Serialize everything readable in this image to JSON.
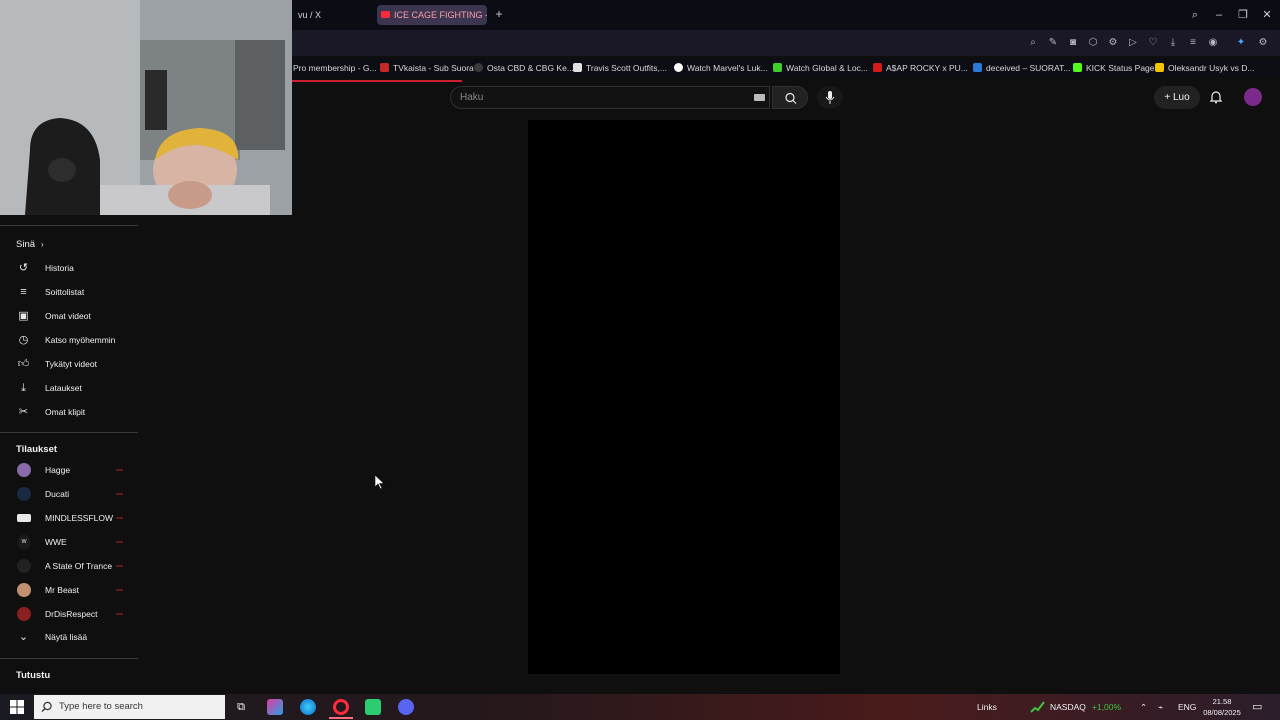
{
  "browser": {
    "tabs": [
      {
        "label": "vu / X"
      },
      {
        "label": "ICE CAGE FIGHTING -"
      }
    ],
    "bookmarks": [
      {
        "label": "Pro membership - G...",
        "color": "#0d0d14"
      },
      {
        "label": "TVkaista - Sub Suora",
        "color": "#c62828"
      },
      {
        "label": "Osta CBD & CBG Ke...",
        "color": "#3a3a3a"
      },
      {
        "label": "Travis Scott Outfits,...",
        "color": "#e0e0e0"
      },
      {
        "label": "Watch Marvel's Luk...",
        "color": "#ffffff"
      },
      {
        "label": "Watch Global & Loc...",
        "color": "#3ecf2a"
      },
      {
        "label": "A$AP ROCKY x PU...",
        "color": "#d61a1a"
      },
      {
        "label": "deceived – SUORAT...",
        "color": "#2a7ad6"
      },
      {
        "label": "KICK Status Page",
        "color": "#53fc18"
      },
      {
        "label": "Oleksandr Usyk vs D...",
        "color": "#f2c500"
      }
    ]
  },
  "header": {
    "search_placeholder": "Haku",
    "create_label": "Luo"
  },
  "sidebar": {
    "you_label": "Sinä",
    "you_items": [
      {
        "label": "Historia",
        "icon": "history-icon"
      },
      {
        "label": "Soittolistat",
        "icon": "playlists-icon"
      },
      {
        "label": "Omat videot",
        "icon": "your-videos-icon"
      },
      {
        "label": "Katso myöhemmin",
        "icon": "watch-later-icon"
      },
      {
        "label": "Tykätyt videot",
        "icon": "liked-icon"
      },
      {
        "label": "Lataukset",
        "icon": "download-icon"
      },
      {
        "label": "Omat klipit",
        "icon": "clips-icon"
      }
    ],
    "subs_label": "Tilaukset",
    "subscriptions": [
      {
        "label": "Hagge",
        "color": "#8a6aa8"
      },
      {
        "label": "Ducati",
        "color": "#1b2a44"
      },
      {
        "label": "MINDLESSFLOW",
        "color": "#e8e8e8"
      },
      {
        "label": "WWE",
        "color": "#1a1a1a"
      },
      {
        "label": "A State Of Trance",
        "color": "#222222"
      },
      {
        "label": "Mr Beast",
        "color": "#c09070"
      },
      {
        "label": "DrDisRespect",
        "color": "#8a2020"
      }
    ],
    "show_more": "Näytä lisää",
    "explore_label": "Tutustu"
  },
  "taskbar": {
    "search_placeholder": "Type here to search",
    "links": "Links",
    "ticker": "NASDAQ",
    "ticker_change": "+1,00%",
    "lang": "ENG",
    "time": "21.58",
    "date": "08/08/2025"
  }
}
